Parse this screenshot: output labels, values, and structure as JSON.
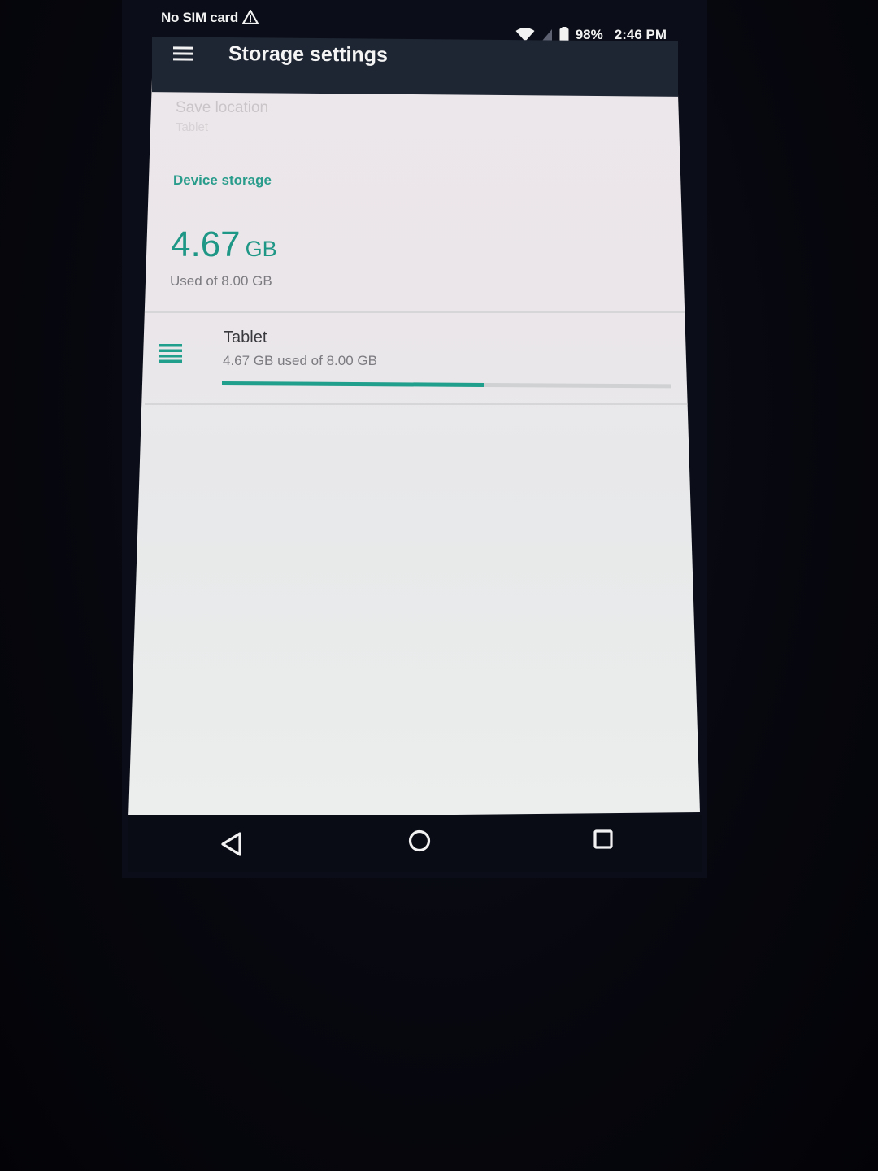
{
  "status_bar": {
    "sim_text": "No SIM card",
    "battery": "98%",
    "time": "2:46 PM"
  },
  "app_bar": {
    "title": "Storage settings"
  },
  "save_location": {
    "title": "Save location",
    "value": "Tablet"
  },
  "device_storage": {
    "header": "Device storage",
    "used_value": "4.67",
    "used_unit": "GB",
    "used_of": "Used of 8.00 GB"
  },
  "storage_item": {
    "title": "Tablet",
    "summary": "4.67 GB used of 8.00 GB",
    "used_fraction": 0.584
  },
  "colors": {
    "accent": "#1f9786",
    "app_bar": "#1e2533",
    "screen_bg": "#ebe7ea"
  },
  "icons": {
    "menu": "menu-icon",
    "warning": "warning-icon",
    "wifi": "wifi-icon",
    "battery": "battery-icon",
    "storage": "storage-list-icon",
    "back": "back-icon",
    "home": "home-icon",
    "recents": "recents-icon"
  }
}
